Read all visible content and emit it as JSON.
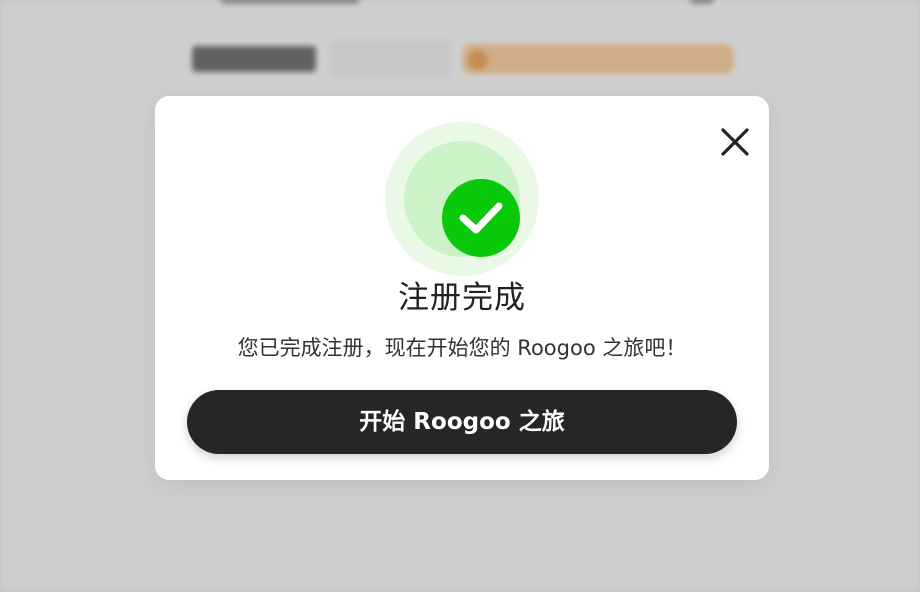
{
  "dialog": {
    "title": "注册完成",
    "message": "您已完成注册，现在开始您的 Roogoo 之旅吧！",
    "primary_button_label": "开始 Roogoo 之旅",
    "success_icon": "check-circle-icon",
    "close_icon": "close-icon"
  },
  "colors": {
    "success_green": "#0ac80a",
    "success_ring": "#ccf2c8",
    "success_halo": "#e9f9e6",
    "button_bg": "#262626",
    "button_text": "#ffffff",
    "title_text": "#222222"
  }
}
